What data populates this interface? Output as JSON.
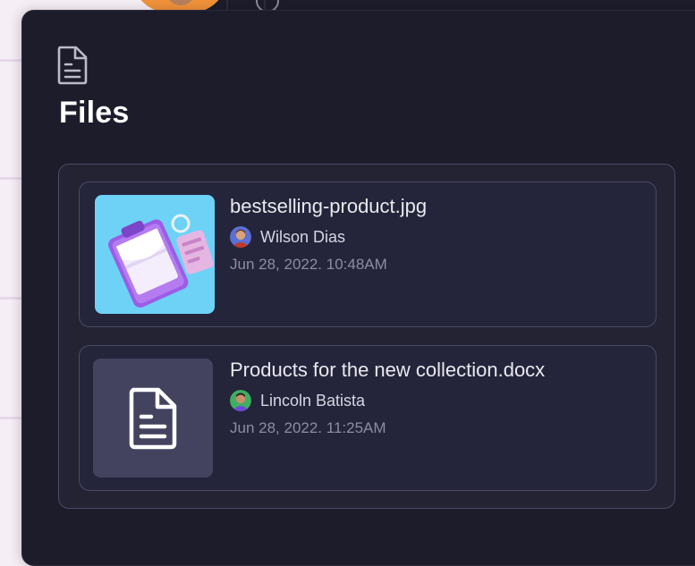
{
  "panel": {
    "title": "Files",
    "header_icon": "document-icon"
  },
  "files": [
    {
      "name": "bestselling-product.jpg",
      "author": "Wilson Dias",
      "date": "Jun 28, 2022. 10:48AM",
      "thumbnail": "clipboard-illustration",
      "avatar_color": "#5b6fd6"
    },
    {
      "name": "Products for the new collection.docx",
      "author": "Lincoln Batista",
      "date": "Jun 28, 2022. 11:25AM",
      "thumbnail": "document-icon",
      "avatar_color": "#3fae62"
    }
  ],
  "colors": {
    "panel_bg": "#1c1c2b",
    "card_bg": "#24243a",
    "border": "#4b4b63",
    "image_thumb_bg": "#6ed2f7",
    "doc_thumb_bg": "#434360"
  }
}
